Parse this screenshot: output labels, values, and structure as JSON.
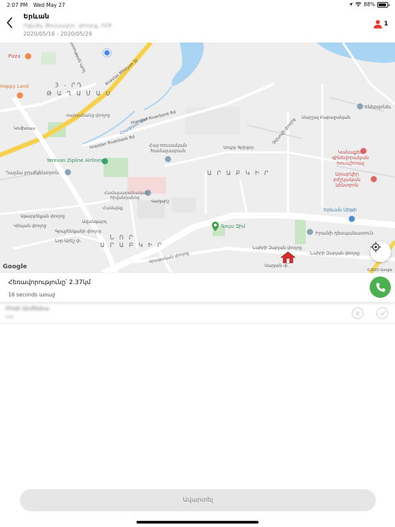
{
  "status_bar": {
    "time": "2:07 PM",
    "date": "Wed May 27",
    "battery": "88%",
    "battery_level": 0.88
  },
  "header": {
    "title": "Երևան",
    "subtitle": "Ոգևծև Թունավոր. փողոց, ՌՈՒ",
    "dates": "2020/05/16 - 2020/05/29",
    "user_count": "1"
  },
  "map": {
    "streets": {
      "azatutyan": "Ազատության պող.",
      "anastas": "Anastas Mikoyan St",
      "hrazdan": "Հրազդան գետ",
      "riverbank": "Hrazdan Riverbank Rd",
      "vagharsh": "Վաղարշ",
      "komitas": "Կոմիտաս",
      "nairi_1": "Նաիրի Զարյան փողոց",
      "nairi_2": "Նաիրի Զարյան փողոց",
      "vratsakan": "Վրացական փողոց",
      "atarbekyan": "Աթարբեկյան փողոց",
      "surb_grigor": "Սուրբ Գրիգոր",
      "chekhov": "Չեխովի փողոց",
      "marshal": "Մարշալ Բաբաջանյան",
      "gyulbekyan": "Գյուլբենկյանի փողոց",
      "avangard": "Ավանգարդ",
      "rd_hrazdan": "Hrazdan Riverbank Rd",
      "nor_street": "Նոր Արեշ փ.",
      "kievyan": "Կիևյան փողոց",
      "saryan": "Սարյան փ."
    },
    "districts": {
      "d3": "3 - ՐԴ",
      "taghamas": "Թ Ա Ղ Ա Մ Ա Ս",
      "arabkir": "Ա Ր Ա Բ Կ Ի Ր",
      "nor": "Ն Ո Ր",
      "nor_arabkir": "Ա Ր Ա Բ Կ Ի Ր"
    },
    "pois": {
      "pizza": "Pizza",
      "happy_land": "Happy Land",
      "ebergynel": "Էներգոնեւ",
      "zipline": "Yerevan Zipline Airlines",
      "dalma": "Դալմա բուժկենտրոն",
      "hay_ruskakan": "Հայ-ռուսական համալսարան",
      "kanaki": "Կանաքեռ գինեվորական հոսպիտալ",
      "arabkir_med": "Արաբկիր բժշկական կենտրոն",
      "hamalsaran": "Համալսարանական հիվանդանոց",
      "yerevan_mall": "Երևան Սիթի",
      "irani": "Իրանի դեսպանատուն",
      "guys_zim": "Գույս Զիմ",
      "vardanank": "Վարդանանց փողոց",
      "hamaynk": "Համայնք"
    },
    "attribution": "Google",
    "copyright": "©2020 Google"
  },
  "info": {
    "distance": "Հեռավորությունը՝ 2.37կմ",
    "time_ago": "16 seconds առաջ"
  },
  "list": [
    {
      "name": "Մոռի Արմենիա",
      "sub": "Սու"
    }
  ],
  "finish_label": "Ավարտել",
  "colors": {
    "accent_red": "#e53935",
    "call_green": "#4caf50",
    "road_yellow": "#f6d458",
    "water_blue": "#a9d4f2",
    "park_green": "#c8e6c4"
  },
  "icons": {
    "back": "chevron-left-icon",
    "user": "user-icon",
    "locate": "crosshair-icon",
    "phone": "phone-icon",
    "reject": "close-icon",
    "accept": "check-icon",
    "wifi": "wifi-icon",
    "location_arrow": "location-arrow-icon",
    "battery": "battery-icon",
    "home_marker": "home-icon",
    "gym_marker": "map-pin-icon",
    "user_location": "user-location-icon"
  }
}
